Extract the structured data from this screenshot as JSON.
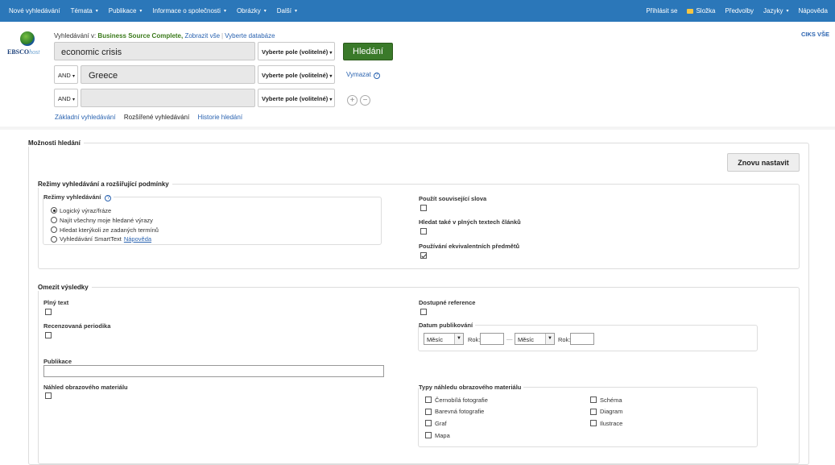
{
  "topnav": {
    "left": [
      {
        "label": "Nové vyhledávání",
        "caret": false
      },
      {
        "label": "Témata",
        "caret": true
      },
      {
        "label": "Publikace",
        "caret": true
      },
      {
        "label": "Informace o společnosti",
        "caret": true
      },
      {
        "label": "Obrázky",
        "caret": true
      },
      {
        "label": "Další",
        "caret": true
      }
    ],
    "right": {
      "signin": "Přihlásit se",
      "folder": "Složka",
      "prefs": "Předvolby",
      "langs": "Jazyky",
      "help": "Nápověda"
    }
  },
  "logo": {
    "brand": "EBSCO",
    "suffix": "host"
  },
  "searching": {
    "prefix": "Vyhledávání v:",
    "db": "Business Source Complete,",
    "show_all": "Zobrazit vše",
    "choose": "Vyberte databáze"
  },
  "ciks": "CIKS VŠE",
  "rows": [
    {
      "bool": "",
      "term": "economic crisis",
      "field": "Vyberte pole (volitelné)"
    },
    {
      "bool": "AND",
      "term": "Greece",
      "field": "Vyberte pole (volitelné)"
    },
    {
      "bool": "AND",
      "term": "",
      "field": "Vyberte pole (volitelné)"
    }
  ],
  "search_button": "Hledání",
  "clear": "Vymazat",
  "tabs": {
    "basic": "Základní vyhledávání",
    "advanced": "Rozšířené vyhledávání",
    "history": "Historie hledání"
  },
  "options": {
    "title": "Možnosti hledání",
    "reset": "Znovu nastavit",
    "modes_section": "Režimy vyhledávání a rozšiřující podmínky",
    "modes_label": "Režimy vyhledávání",
    "modes": [
      {
        "label": "Logický výraz/fráze",
        "selected": true
      },
      {
        "label": "Najít všechny moje hledané výrazy",
        "selected": false
      },
      {
        "label": "Hledat kterýkoli ze zadaných termínů",
        "selected": false
      },
      {
        "label": "Vyhledávání SmartText",
        "selected": false,
        "link": "Nápověda"
      }
    ],
    "expanders": [
      {
        "label": "Použít související slova",
        "checked": false
      },
      {
        "label": "Hledat také v plných textech článků",
        "checked": false
      },
      {
        "label": "Používání ekvivalentních předmětů",
        "checked": true
      }
    ],
    "limit_section": "Omezit výsledky",
    "fulltext": "Plný text",
    "peer": "Recenzovaná periodika",
    "references": "Dostupné reference",
    "pubdate": "Datum publikování",
    "month": "Měsíc",
    "year": "Rok:",
    "dash": "—",
    "publication": "Publikace",
    "image_quick": "Náhled obrazového materiálu",
    "image_types_label": "Typy náhledu obrazového materiálu",
    "image_types_col1": [
      "Černobílá fotografie",
      "Barevná fotografie",
      "Graf",
      "Mapa"
    ],
    "image_types_col2": [
      "Schéma",
      "Diagram",
      "Ilustrace"
    ]
  }
}
